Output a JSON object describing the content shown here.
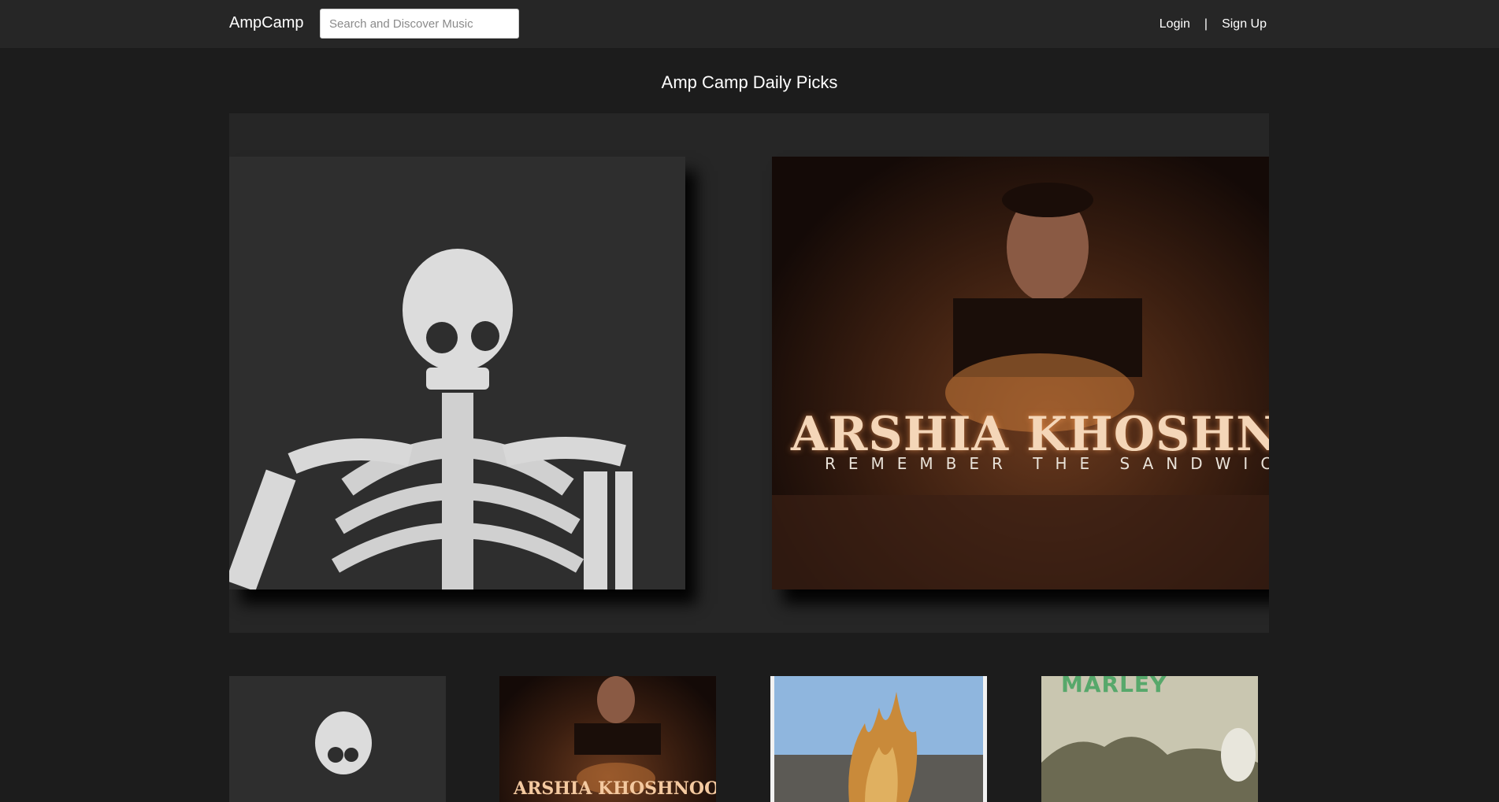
{
  "header": {
    "logo": "AmpCamp",
    "search_placeholder": "Search and Discover Music",
    "login_label": "Login",
    "separator": "|",
    "signup_label": "Sign Up"
  },
  "main": {
    "title": "Amp Camp Daily Picks"
  },
  "carousel": {
    "slides": [
      {
        "art": "skeleton-album-cover"
      },
      {
        "art": "arshia-khoshnood-album-cover",
        "artist_text": "ARSHIA KHOSHNOOD",
        "subtitle_text": "REMEMBER THE SANDWICH"
      }
    ]
  },
  "thumbnails": [
    {
      "art": "skeleton-album-cover"
    },
    {
      "art": "arshia-khoshnood-album-cover",
      "artist_text": "ARSHIA KHOSHNOOD"
    },
    {
      "art": "flame-album-cover"
    },
    {
      "art": "marley-album-cover",
      "artist_text": "MARLEY"
    }
  ],
  "colors": {
    "page_bg": "#1c1c1c",
    "header_bg": "#262626",
    "carousel_bg": "#262626",
    "text": "#ffffff"
  }
}
